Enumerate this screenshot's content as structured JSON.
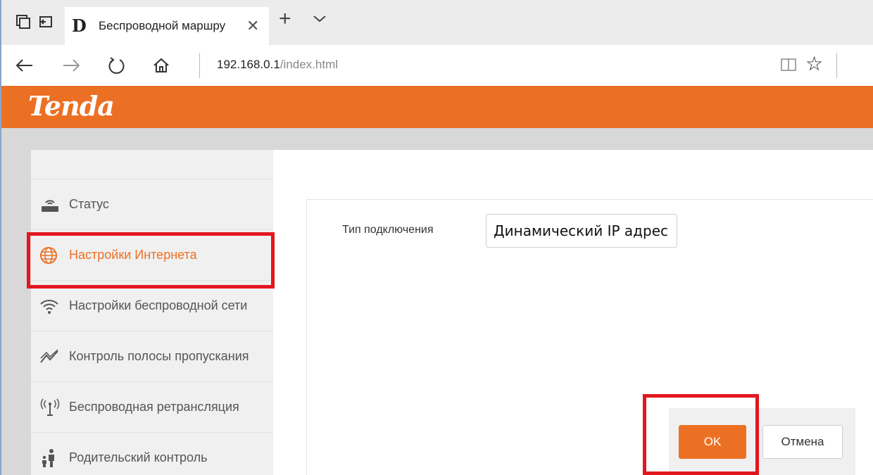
{
  "browser": {
    "tab_title": "Беспроводной маршру",
    "tab_favicon": "D",
    "url_host": "192.168.0.1",
    "url_path": "/index.html"
  },
  "header": {
    "logo": "Tenda",
    "accent_color": "#ec7024"
  },
  "sidebar": {
    "items": [
      {
        "label": "Статус",
        "icon": "router-icon"
      },
      {
        "label": "Настройки Интернета",
        "icon": "globe-icon",
        "active": true
      },
      {
        "label": "Настройки беспроводной сети",
        "icon": "wifi-icon"
      },
      {
        "label": "Контроль полосы пропускания",
        "icon": "bandwidth-icon"
      },
      {
        "label": "Беспроводная ретрансляция",
        "icon": "repeater-icon"
      },
      {
        "label": "Родительский контроль",
        "icon": "parental-icon"
      }
    ]
  },
  "form": {
    "connection_type_label": "Тип подключения",
    "connection_type_value": "Динамический IP адрес"
  },
  "buttons": {
    "ok": "OK",
    "cancel": "Отмена"
  },
  "highlight_color": "#e2171e"
}
